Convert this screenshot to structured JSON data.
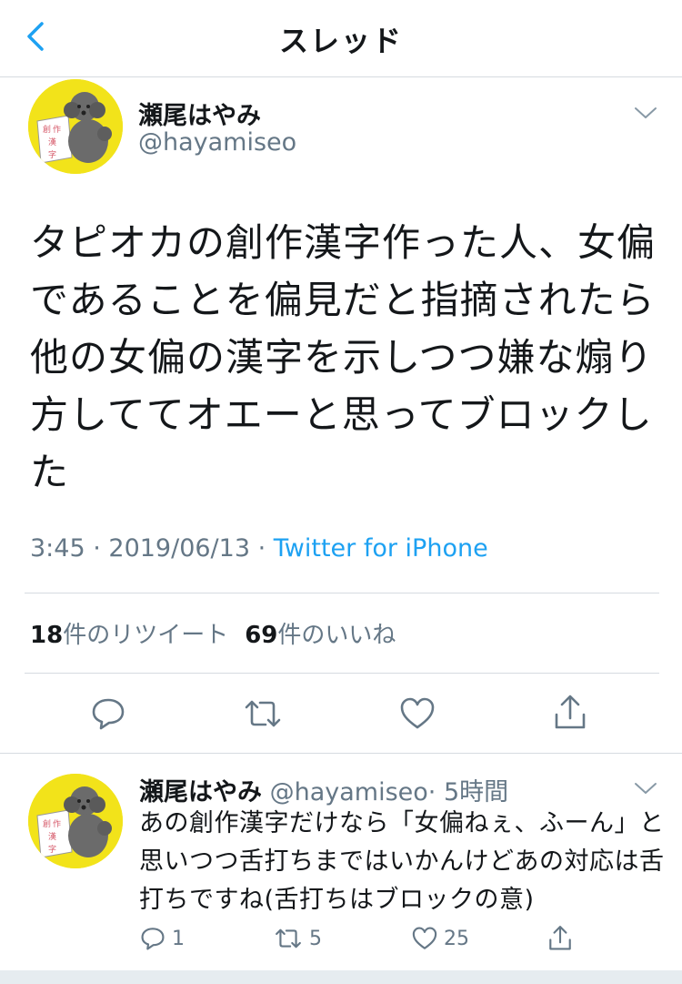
{
  "nav": {
    "title": "スレッド"
  },
  "main_tweet": {
    "display_name": "瀬尾はやみ",
    "handle": "@hayamiseo",
    "text": "タピオカの創作漢字作った人、女偏であることを偏見だと指摘されたら他の女偏の漢字を示しつつ嫌な煽り方しててオエーと思ってブロックした",
    "time": "3:45",
    "date": "2019/06/13",
    "meta_separator": " · ",
    "source": "Twitter for iPhone",
    "retweet_count": "18",
    "retweet_label": "件のリツイート",
    "like_count": "69",
    "like_label": "件のいいね"
  },
  "reply": {
    "display_name": "瀬尾はやみ",
    "handle": "@hayamiseo",
    "time_ago": "· 5時間",
    "text": "あの創作漢字だけなら「女偏ねぇ、ふーん」と思いつつ舌打ちまではいかんけどあの対応は舌打ちですね(舌打ちはブロックの意)",
    "reply_count": "1",
    "retweet_count": "5",
    "like_count": "25"
  },
  "colors": {
    "accent": "#1da1f2",
    "secondary_text": "#657786",
    "divider": "#d6dbe0",
    "avatar_bg": "#f2e31a"
  },
  "icons": [
    "back-chevron-icon",
    "chevron-down-icon",
    "reply-icon",
    "retweet-icon",
    "like-icon",
    "share-icon"
  ]
}
